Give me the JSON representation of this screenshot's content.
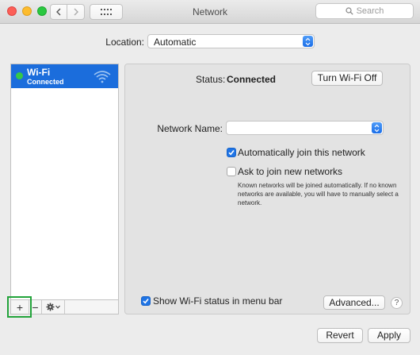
{
  "window": {
    "title": "Network",
    "search_placeholder": "Search"
  },
  "location": {
    "label": "Location:",
    "value": "Automatic"
  },
  "sidebar": {
    "services": [
      {
        "name": "Wi-Fi",
        "status": "Connected",
        "status_color": "#35c847"
      }
    ],
    "toolbar": {
      "add": "+",
      "remove": "−"
    }
  },
  "panel": {
    "status_label": "Status:",
    "status_value": "Connected",
    "turn_off_button": "Turn Wi-Fi Off",
    "network_name_label": "Network Name:",
    "network_name_value": "",
    "auto_join": {
      "label": "Automatically join this network",
      "checked": true
    },
    "ask_join": {
      "label": "Ask to join new networks",
      "checked": false,
      "help": "Known networks will be joined automatically. If no known networks are available, you will have to manually select a network."
    },
    "show_status": {
      "label": "Show Wi-Fi status in menu bar",
      "checked": true
    },
    "advanced_button": "Advanced...",
    "help_button": "?"
  },
  "footer": {
    "revert_button": "Revert",
    "apply_button": "Apply"
  },
  "colors": {
    "accent": "#1f74e5",
    "selection": "#1b6ddc",
    "highlight_box": "#22a33a"
  }
}
